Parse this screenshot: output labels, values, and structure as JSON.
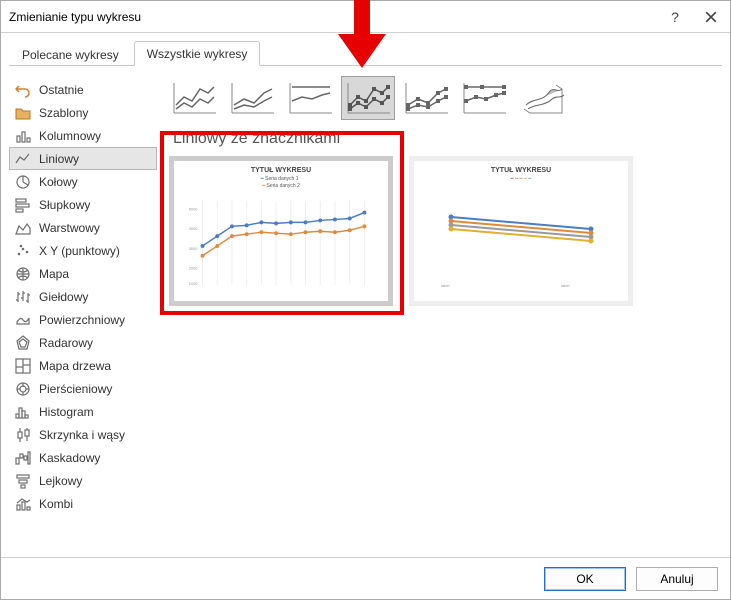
{
  "title": "Zmienianie typu wykresu",
  "tabs": [
    {
      "label": "Polecane wykresy",
      "active": false
    },
    {
      "label": "Wszystkie wykresy",
      "active": true
    }
  ],
  "sidebar": [
    {
      "label": "Ostatnie",
      "icon": "undo-icon"
    },
    {
      "label": "Szablony",
      "icon": "folder-icon"
    },
    {
      "label": "Kolumnowy",
      "icon": "column-icon"
    },
    {
      "label": "Liniowy",
      "icon": "line-icon",
      "selected": true
    },
    {
      "label": "Kołowy",
      "icon": "pie-icon"
    },
    {
      "label": "Słupkowy",
      "icon": "bar-icon"
    },
    {
      "label": "Warstwowy",
      "icon": "area-icon"
    },
    {
      "label": "X Y (punktowy)",
      "icon": "scatter-icon"
    },
    {
      "label": "Mapa",
      "icon": "map-icon"
    },
    {
      "label": "Giełdowy",
      "icon": "stock-icon"
    },
    {
      "label": "Powierzchniowy",
      "icon": "surface-icon"
    },
    {
      "label": "Radarowy",
      "icon": "radar-icon"
    },
    {
      "label": "Mapa drzewa",
      "icon": "treemap-icon"
    },
    {
      "label": "Pierścieniowy",
      "icon": "sunburst-icon"
    },
    {
      "label": "Histogram",
      "icon": "histogram-icon"
    },
    {
      "label": "Skrzynka i wąsy",
      "icon": "box-icon"
    },
    {
      "label": "Kaskadowy",
      "icon": "waterfall-icon"
    },
    {
      "label": "Lejkowy",
      "icon": "funnel-icon"
    },
    {
      "label": "Kombi",
      "icon": "combo-icon"
    }
  ],
  "subtype_title": "Liniowy ze znacznikami",
  "preview_title": "TYTUŁ WYKRESU",
  "button_ok": "OK",
  "button_cancel": "Anuluj",
  "chart_data": {
    "type": "line",
    "title": "TYTUŁ WYKRESU",
    "series": [
      {
        "name": "Seria 1",
        "color": "#4a7ec0",
        "values": [
          3400,
          3800,
          4200,
          4250,
          4400,
          4350,
          4380,
          4400,
          4500,
          4550,
          4600,
          4900
        ]
      },
      {
        "name": "Seria 2",
        "color": "#e08a3e",
        "values": [
          3000,
          3400,
          3800,
          3900,
          4000,
          3950,
          3900,
          4000,
          4050,
          4000,
          4100,
          4300
        ]
      }
    ],
    "ylim": [
      1000,
      5000
    ]
  }
}
